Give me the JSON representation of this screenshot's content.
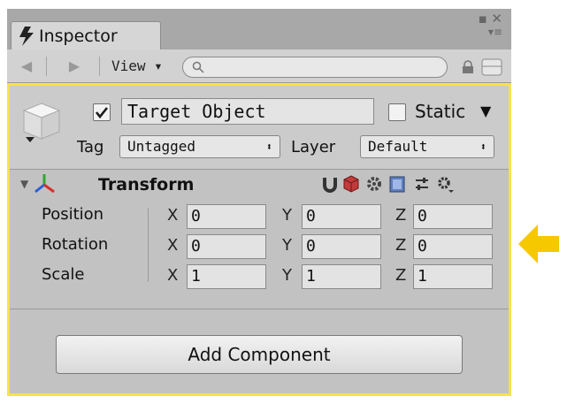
{
  "tab": {
    "label": "Inspector"
  },
  "toolbar": {
    "view_label": "View ▾",
    "search_placeholder": ""
  },
  "game_object": {
    "active": true,
    "name": "Target Object",
    "static_label": "Static",
    "static_checked": false,
    "tag_label": "Tag",
    "tag_value": "Untagged",
    "layer_label": "Layer",
    "layer_value": "Default"
  },
  "transform": {
    "title": "Transform",
    "rows": [
      {
        "label": "Position",
        "x": "0",
        "y": "0",
        "z": "0"
      },
      {
        "label": "Rotation",
        "x": "0",
        "y": "0",
        "z": "0"
      },
      {
        "label": "Scale",
        "x": "1",
        "y": "1",
        "z": "1"
      }
    ],
    "axis_labels": {
      "x": "X",
      "y": "Y",
      "z": "Z"
    }
  },
  "add_component_label": "Add Component",
  "colors": {
    "highlight": "#f5e348",
    "arrow": "#f5c800",
    "panel": "#c2c2c2"
  },
  "icons": [
    "bolt-icon",
    "lock-icon",
    "layout-icon",
    "cube-icon",
    "transform-axes-icon",
    "magnet-icon",
    "cube-tool-icon",
    "gear-icon",
    "help-icon",
    "settings-slider-icon",
    "cog-icon",
    "arrow-left-icon"
  ]
}
